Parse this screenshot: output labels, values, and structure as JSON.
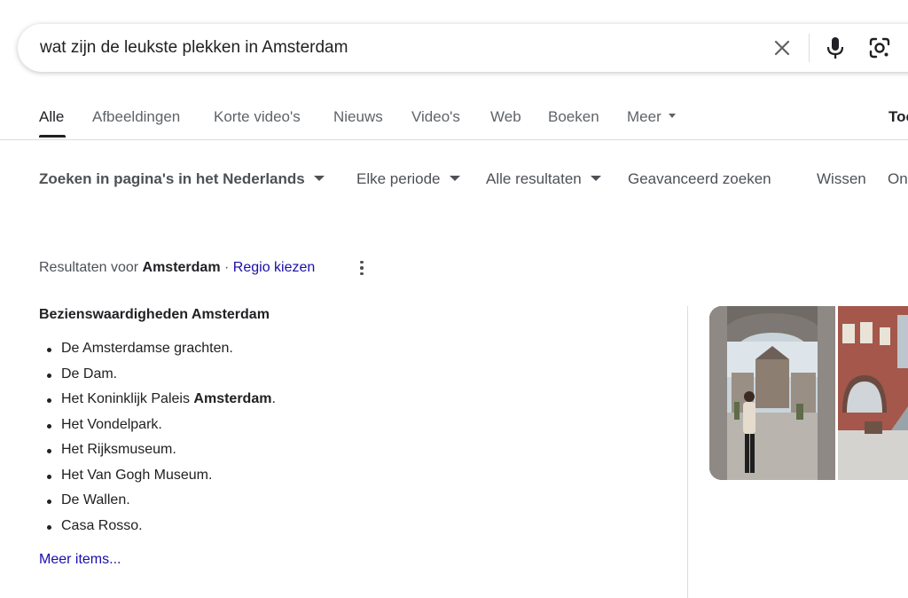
{
  "search": {
    "query": "wat zijn de leukste plekken in Amsterdam"
  },
  "tabs": [
    {
      "label": "Alle",
      "active": true
    },
    {
      "label": "Afbeeldingen"
    },
    {
      "label": "Korte video's"
    },
    {
      "label": "Nieuws"
    },
    {
      "label": "Video's"
    },
    {
      "label": "Web"
    },
    {
      "label": "Boeken"
    },
    {
      "label": "Meer"
    },
    {
      "label": "Too"
    }
  ],
  "tools": {
    "language": "Zoeken in pagina's in het Nederlands",
    "period": "Elke periode",
    "results": "Alle resultaten",
    "advanced": "Geavanceerd zoeken",
    "clear": "Wissen",
    "cut": "On"
  },
  "region": {
    "prefix": "Resultaten voor",
    "place": "Amsterdam",
    "separator": "·",
    "link": "Regio kiezen"
  },
  "snippet": {
    "title": "Bezienswaardigheden Amsterdam",
    "items": [
      {
        "text": "De Amsterdamse grachten."
      },
      {
        "text": "De Dam."
      },
      {
        "text": "Het Koninklijk Paleis ",
        "bold": "Amsterdam",
        "suffix": "."
      },
      {
        "text": "Het Vondelpark."
      },
      {
        "text": "Het Rijksmuseum."
      },
      {
        "text": "Het Van Gogh Museum."
      },
      {
        "text": "De Wallen."
      },
      {
        "text": "Casa Rosso."
      }
    ],
    "more": "Meer items..."
  },
  "colors": {
    "link": "#1a0dab",
    "text": "#202124",
    "muted": "#5f6368"
  },
  "icons": [
    "close-icon",
    "microphone-icon",
    "google-lens-icon",
    "caret-down-icon",
    "more-vert-icon"
  ]
}
